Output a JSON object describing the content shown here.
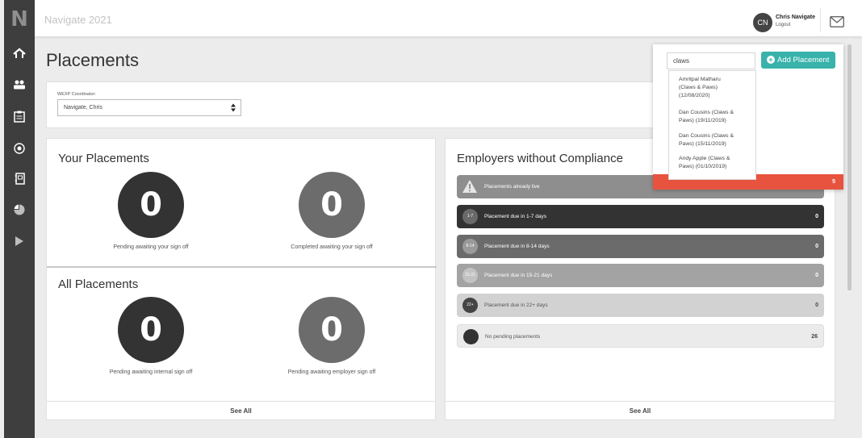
{
  "app": {
    "title": "Navigate 2021",
    "logo_letter": "N"
  },
  "user": {
    "initials": "CN",
    "name": "Chris Navigate",
    "logout_label": "Logout"
  },
  "page": {
    "title": "Placements"
  },
  "coordinator": {
    "label": "WEXP Coordinator:",
    "selected": "Navigate, Chris"
  },
  "search": {
    "value": "claws",
    "add_button_label": "Add Placement",
    "results": [
      {
        "line1": "Amritpal Matharu",
        "line2": "(Claws & Paws)",
        "line3": "(12/08/2020)"
      },
      {
        "line1": "Dan Cousins (Claws &",
        "line2": "Paws) (19/11/2019)"
      },
      {
        "line1": "Dan Cousins (Claws &",
        "line2": "Paws) (15/11/2019)"
      },
      {
        "line1": "Andy Apple (Claws &",
        "line2": "Paws) (01/10/2019)"
      }
    ]
  },
  "your_placements": {
    "heading": "Your Placements",
    "pending": {
      "value": "0",
      "label": "Pending awaiting your sign off"
    },
    "completed": {
      "value": "0",
      "label": "Completed awaiting your sign off"
    }
  },
  "all_placements": {
    "heading": "All Placements",
    "internal": {
      "value": "0",
      "label": "Pending awaiting internal sign off"
    },
    "employer": {
      "value": "0",
      "label": "Pending awaiting employer sign off"
    }
  },
  "compliance": {
    "heading": "Employers without Compliance",
    "rows": [
      {
        "badge": "",
        "label": "Placements already live",
        "count": "5",
        "color": "#8e8e8e"
      },
      {
        "badge": "1-7",
        "label": "Placement due in 1-7 days",
        "count": "0",
        "color": "#333333"
      },
      {
        "badge": "8-14",
        "label": "Placement due in 8-14 days",
        "count": "0",
        "color": "#6b6b6b"
      },
      {
        "badge": "15-21",
        "label": "Placement due in 15-21 days",
        "count": "0",
        "color": "#a3a3a3"
      },
      {
        "badge": "22+",
        "label": "Placement due in 22+ days",
        "count": "0",
        "color": "#d2d2d2"
      },
      {
        "badge": "",
        "label": "No pending placements",
        "count": "26",
        "color": "#ebebeb"
      }
    ],
    "alert_color": "#e8533f"
  },
  "footer": {
    "see_all_label": "See All"
  },
  "colors": {
    "accent": "#38b2aa",
    "sidebar": "#3e3e3e"
  },
  "sidebar_icons": [
    "home-icon",
    "people-icon",
    "clipboard-icon",
    "target-icon",
    "notebook-icon",
    "pie-chart-icon",
    "play-icon"
  ]
}
